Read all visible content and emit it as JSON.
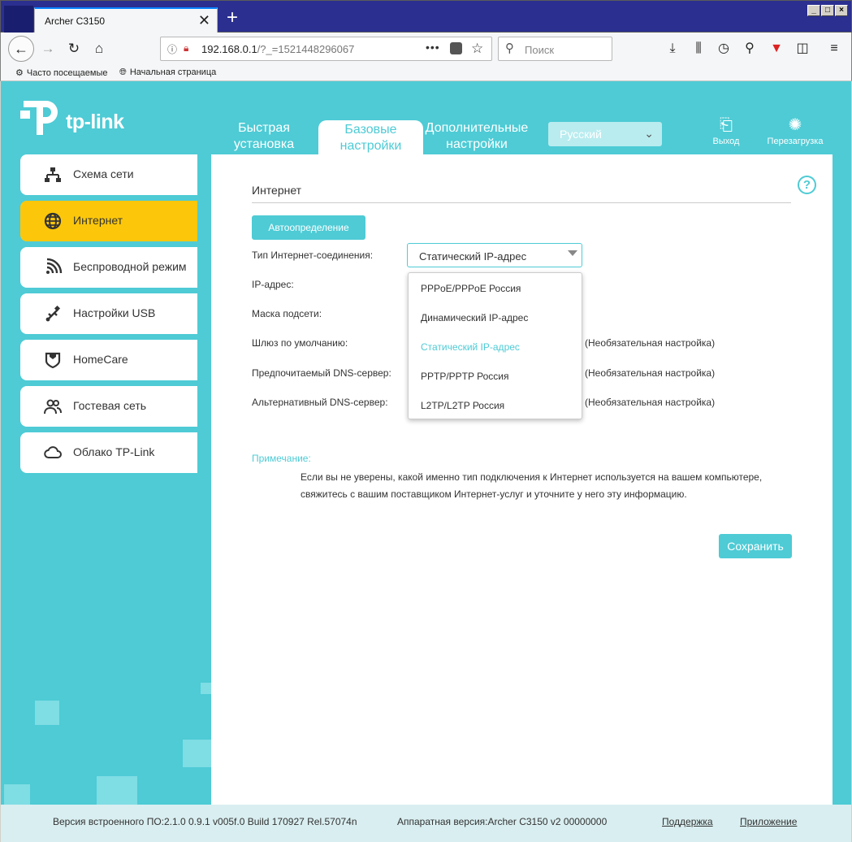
{
  "browser": {
    "tab_title": "Archer C3150",
    "tab_close": "✕",
    "new_tab": "+",
    "url_host": "192.168.0.1",
    "url_path": "/?_=1521448296067",
    "search_placeholder": "Поиск",
    "bookmarks": [
      "Часто посещаемые",
      "Начальная страница"
    ],
    "accent_color": "#0a84ff"
  },
  "router": {
    "brand": "tp-link",
    "nav": {
      "quick_setup": "Быстрая установка",
      "basic": "Базовые настройки",
      "advanced": "Дополнительные настройки"
    },
    "language": "Русский",
    "logout": "Выход",
    "reboot": "Перезагрузка",
    "brand_color": "#4ecbd5",
    "active_color": "#fcc70a"
  },
  "sidebar": {
    "items": [
      {
        "label": "Схема сети",
        "icon": "network-map-icon"
      },
      {
        "label": "Интернет",
        "icon": "globe-icon"
      },
      {
        "label": "Беспроводной режим",
        "icon": "wireless-icon"
      },
      {
        "label": "Настройки USB",
        "icon": "usb-icon"
      },
      {
        "label": "HomeCare",
        "icon": "shield-icon"
      },
      {
        "label": "Гостевая сеть",
        "icon": "guests-icon"
      },
      {
        "label": "Облако TP-Link",
        "icon": "cloud-icon"
      }
    ]
  },
  "internet": {
    "title": "Интернет",
    "auto_detect": "Автоопределение",
    "connection_type_label": "Тип Интернет-соединения:",
    "connection_type_value": "Статический IP-адрес",
    "fields": {
      "ip": "IP-адрес:",
      "mask": "Маска подсети:",
      "gateway": "Шлюз по умолчанию:",
      "dns1": "Предпочитаемый DNS-сервер:",
      "dns2": "Альтернативный DNS-сервер:"
    },
    "optional": "(Необязательная настройка)",
    "options": [
      "PPPoE/PPPoE Россия",
      "Динамический IP-адрес",
      "Статический IP-адрес",
      "PPTP/PPTP Россия",
      "L2TP/L2TP Россия"
    ],
    "note_title": "Примечание:",
    "note_text": "Если вы не уверены, какой именно тип подключения к Интернет используется на вашем компьютере, свяжитесь с вашим поставщиком Интернет-услуг и уточните у него эту информацию.",
    "save": "Сохранить"
  },
  "footer": {
    "firmware": "Версия встроенного ПО:2.1.0 0.9.1 v005f.0 Build 170927 Rel.57074n",
    "hardware": "Аппаратная версия:Archer C3150 v2 00000000",
    "support": "Поддержка",
    "app": "Приложение"
  }
}
